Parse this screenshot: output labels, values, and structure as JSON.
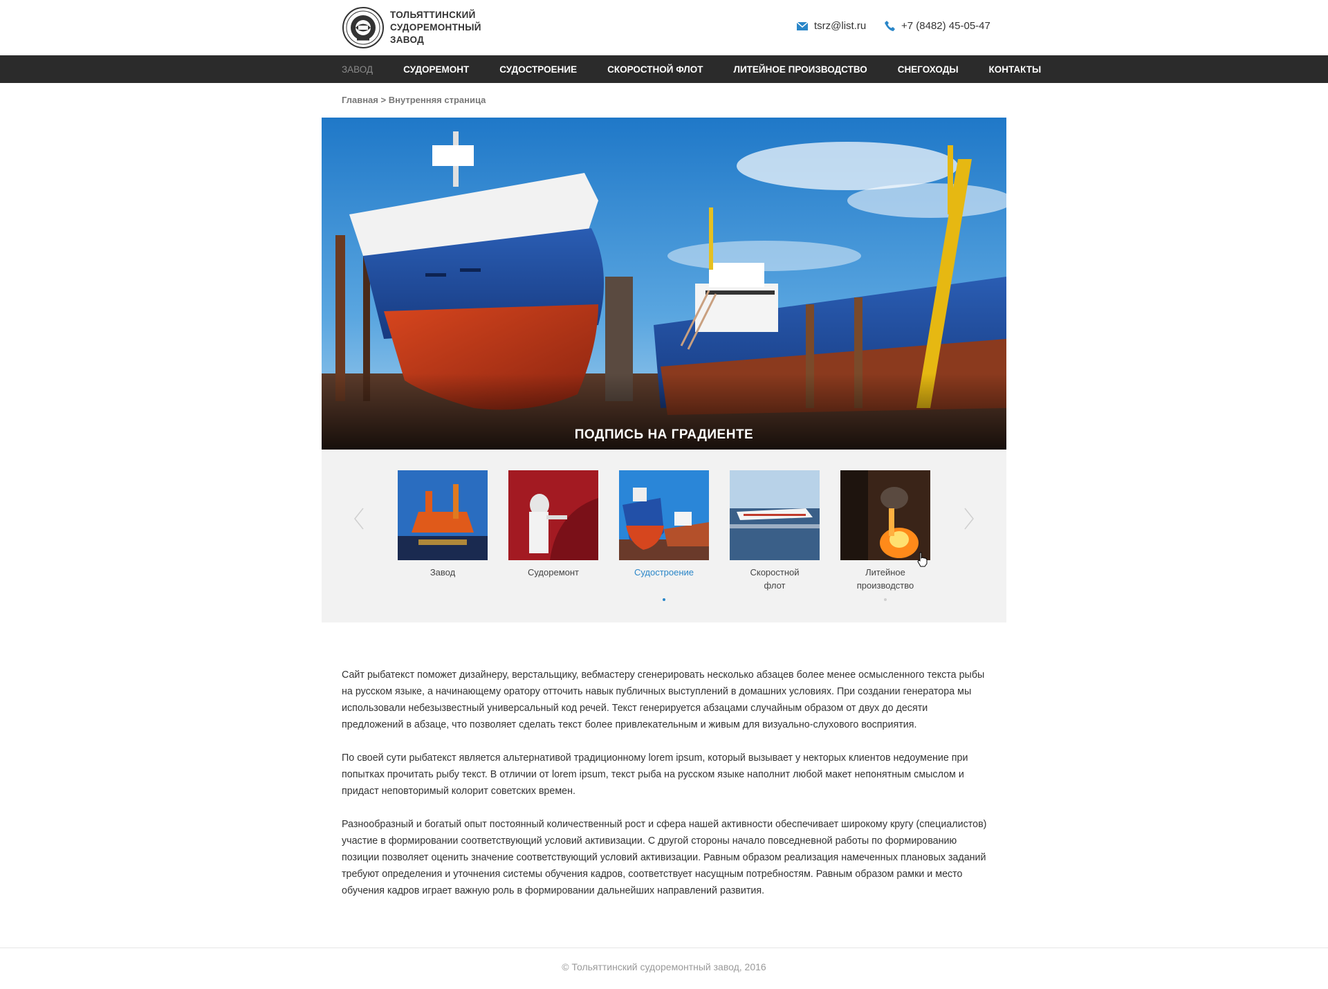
{
  "header": {
    "brand_lines": [
      "Тольяттинский",
      "судоремонтный",
      "завод"
    ],
    "email": "tsrz@list.ru",
    "phone": "+7 (8482) 45-05-47"
  },
  "nav": {
    "items": [
      {
        "label": "Завод",
        "active": true
      },
      {
        "label": "Судоремонт"
      },
      {
        "label": "Судостроение"
      },
      {
        "label": "Скоростной флот"
      },
      {
        "label": "Литейное производство"
      },
      {
        "label": "Снегоходы"
      },
      {
        "label": "Контакты"
      }
    ]
  },
  "breadcrumb": {
    "home": "Главная",
    "separator": " > ",
    "current": "Внутренняя страница"
  },
  "hero": {
    "caption": "Подпись на градиенте"
  },
  "carousel": {
    "items": [
      {
        "label": "Завод"
      },
      {
        "label": "Судоремонт"
      },
      {
        "label": "Судостроение",
        "active": true
      },
      {
        "label_line1": "Скоростной",
        "label_line2": "флот"
      },
      {
        "label_line1": "Литейное",
        "label_line2": "производство"
      }
    ],
    "active_color": "#2a86c8"
  },
  "content": {
    "paragraphs": [
      "Сайт рыбатекст поможет дизайнеру, верстальщику, вебмастеру сгенерировать несколько абзацев более менее осмысленного текста рыбы на русском языке, а начинающему оратору отточить навык публичных выступлений в домашних условиях. При создании генератора мы использовали небезызвестный универсальный код речей. Текст генерируется абзацами случайным образом от двух до десяти предложений в абзаце, что позволяет сделать текст более привлекательным и живым для визуально-слухового восприятия.",
      "По своей сути рыбатекст является альтернативой традиционному lorem ipsum, который вызывает у некторых клиентов недоумение при попытках прочитать рыбу текст. В отличии от lorem ipsum, текст рыба на русском языке наполнит любой макет непонятным смыслом и придаст неповторимый колорит советских времен.",
      "Разнообразный и богатый опыт постоянный количественный рост и сфера нашей активности обеспечивает широкому кругу (специалистов) участие в формировании соответствующий условий активизации. С другой стороны начало повседневной работы по формированию позиции позволяет оценить значение соответствующий условий активизации. Равным образом реализация намеченных плановых заданий требуют определения и уточнения системы обучения кадров, соответствует насущным потребностям. Равным образом рамки и место обучения кадров играет важную роль в формировании дальнейших направлений развития."
    ]
  },
  "footer": {
    "copyright": "© Тольяттинский судоремонтный завод, 2016"
  },
  "colors": {
    "nav_bg": "#2b2b2b",
    "accent": "#2a86c8"
  }
}
